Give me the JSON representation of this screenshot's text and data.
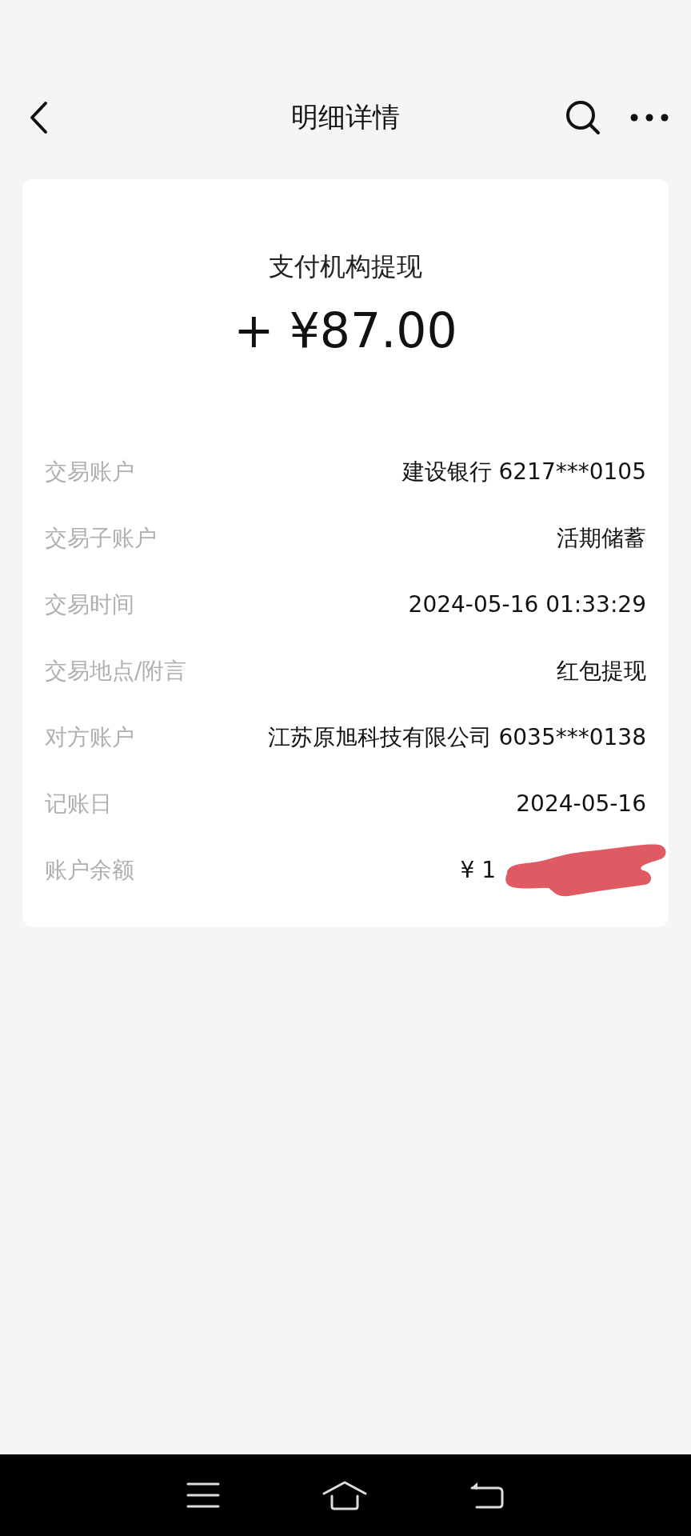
{
  "header": {
    "title": "明细详情"
  },
  "summary": {
    "title": "支付机构提现",
    "amount": "+ ¥87.00"
  },
  "rows": [
    {
      "label": "交易账户",
      "value": "建设银行 6217***0105"
    },
    {
      "label": "交易子账户",
      "value": "活期储蓄"
    },
    {
      "label": "交易时间",
      "value": "2024-05-16 01:33:29"
    },
    {
      "label": "交易地点/附言",
      "value": "红包提现"
    },
    {
      "label": "对方账户",
      "value": "江苏原旭科技有限公司 6035***0138"
    },
    {
      "label": "记账日",
      "value": "2024-05-16"
    },
    {
      "label": "账户余额",
      "value": "¥ 1",
      "redacted": true
    }
  ]
}
